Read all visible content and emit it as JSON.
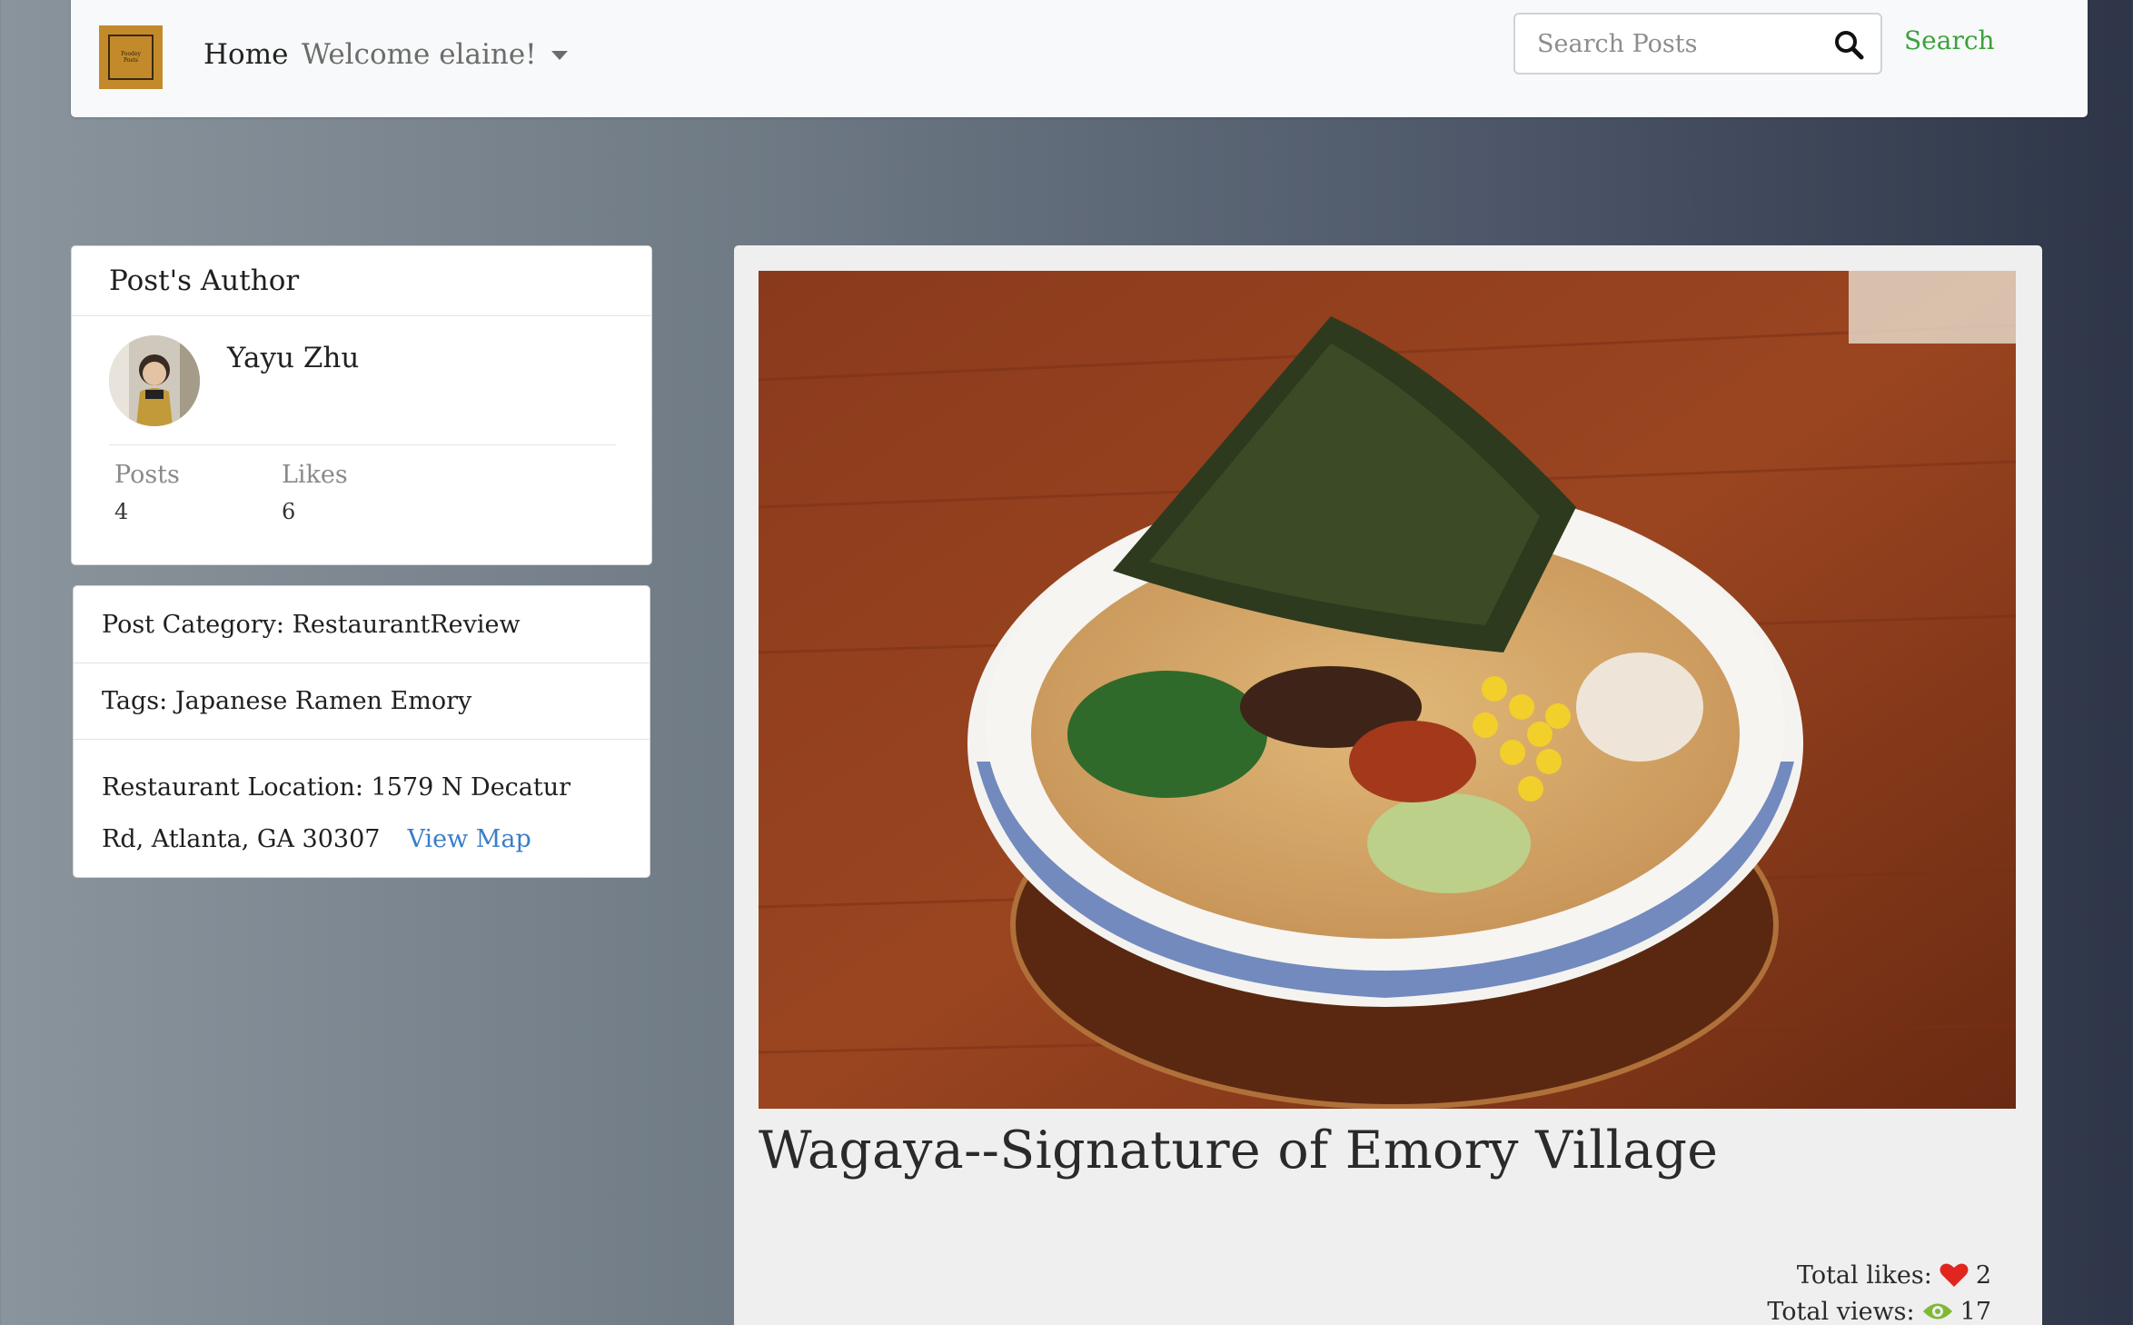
{
  "nav": {
    "logo_text_line1": "Foodey",
    "logo_text_line2": "Posts",
    "home_label": "Home",
    "welcome_label": "Welcome elaine!",
    "search_placeholder": "Search Posts",
    "search_label": "Search"
  },
  "author": {
    "header": "Post's Author",
    "name": "Yayu Zhu",
    "posts_label": "Posts",
    "posts_value": "4",
    "likes_label": "Likes",
    "likes_value": "6"
  },
  "info": {
    "category": "Post Category: RestaurantReview",
    "tags": "Tags: Japanese Ramen Emory",
    "location": "Restaurant Location: 1579 N Decatur Rd, Atlanta, GA 30307",
    "view_map": "View Map"
  },
  "post": {
    "title": "Wagaya--Signature of Emory Village",
    "likes_label": "Total likes:",
    "likes_value": "2",
    "views_label": "Total views:",
    "views_value": "17"
  },
  "colors": {
    "search_link": "#3aa23a",
    "link": "#3a7dc9",
    "heart": "#e0261f",
    "eye": "#7fb935"
  }
}
